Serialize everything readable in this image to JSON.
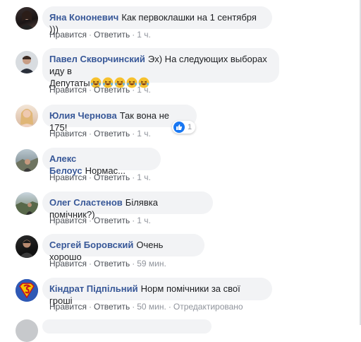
{
  "comments": [
    {
      "author": "Яна Кононевич",
      "text": "Как первоклашки на 1 сентября )))",
      "like": "Нравится",
      "reply": "Ответить",
      "time": "1 ч."
    },
    {
      "author": "Павел Скворчинский",
      "text_line1": "Эх) На следующих выборах иду в",
      "text_line2": "Депутаты",
      "like": "Нравится",
      "reply": "Ответить",
      "time": "1 ч."
    },
    {
      "author": "Юлия Чернова",
      "text": "Так вона не 175!",
      "like": "Нравится",
      "reply": "Ответить",
      "time": "1 ч.",
      "reaction_count": "1"
    },
    {
      "author": "Алекс Белоус",
      "text": "Нормас...",
      "like": "Нравится",
      "reply": "Ответить",
      "time": "1 ч."
    },
    {
      "author": "Олег Сластенов",
      "text": "Білявка помічник?)",
      "like": "Нравится",
      "reply": "Ответить",
      "time": "1 ч."
    },
    {
      "author": "Сергей Боровский",
      "text": "Очень хорошо",
      "like": "Нравится",
      "reply": "Ответить",
      "time": "59 мин."
    },
    {
      "author": "Кіндрат Підпільний",
      "text": "Норм помічники за свої гроші",
      "like": "Нравится",
      "reply": "Ответить",
      "time": "50 мин.",
      "edited": "Отредактировано"
    }
  ]
}
